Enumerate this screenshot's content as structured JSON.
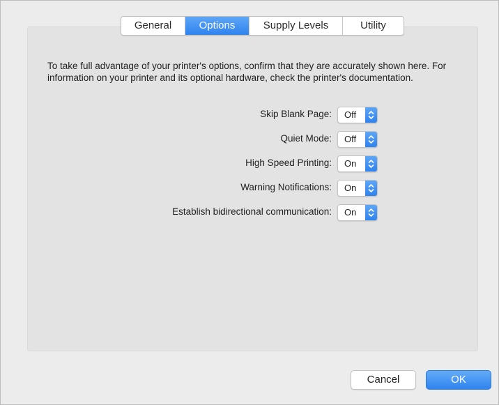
{
  "tabs": [
    {
      "label": "General",
      "active": false
    },
    {
      "label": "Options",
      "active": true
    },
    {
      "label": "Supply Levels",
      "active": false
    },
    {
      "label": "Utility",
      "active": false
    }
  ],
  "intro_text": "To take full advantage of your printer's options, confirm that they are accurately shown here. For information on your printer and its optional hardware, check the printer's documentation.",
  "options": [
    {
      "label": "Skip Blank Page:",
      "value": "Off"
    },
    {
      "label": "Quiet Mode:",
      "value": "Off"
    },
    {
      "label": "High Speed Printing:",
      "value": "On"
    },
    {
      "label": "Warning Notifications:",
      "value": "On"
    },
    {
      "label": "Establish bidirectional communication:",
      "value": "On"
    }
  ],
  "buttons": {
    "cancel": "Cancel",
    "ok": "OK"
  },
  "colors": {
    "accent": "#2f83ee",
    "window_bg": "#ececec",
    "panel_bg": "#e3e3e3"
  },
  "icons": {
    "popup_arrow": "up-down-chevron-icon"
  }
}
